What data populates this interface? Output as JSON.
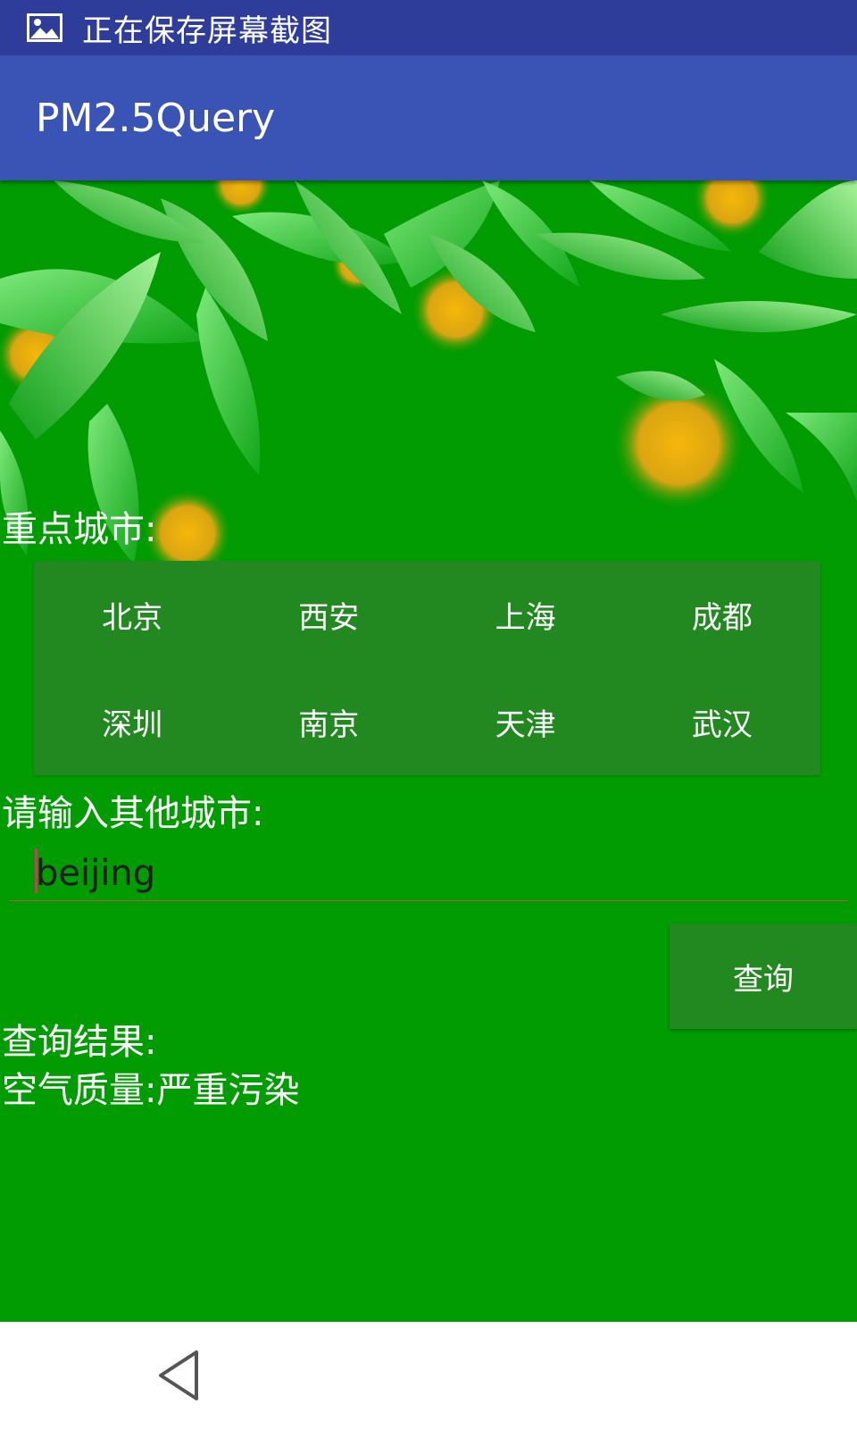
{
  "status_bar": {
    "text": "正在保存屏幕截图",
    "icon": "image-icon"
  },
  "app_bar": {
    "title": "PM2.5Query"
  },
  "labels": {
    "key_cities": "重点城市:",
    "other_city": "请输入其他城市:",
    "result_title": "查询结果:"
  },
  "cities": [
    "北京",
    "西安",
    "上海",
    "成都",
    "深圳",
    "南京",
    "天津",
    "武汉"
  ],
  "input": {
    "value": "beijing"
  },
  "query_button": {
    "label": "查询"
  },
  "result": {
    "text": "空气质量:严重污染"
  },
  "nav_bar": {
    "back_icon": "back-triangle-icon"
  },
  "colors": {
    "status_bar": "#2e3d99",
    "app_bar": "#3a54b6",
    "background": "#019b02",
    "panel": "#21891f"
  }
}
